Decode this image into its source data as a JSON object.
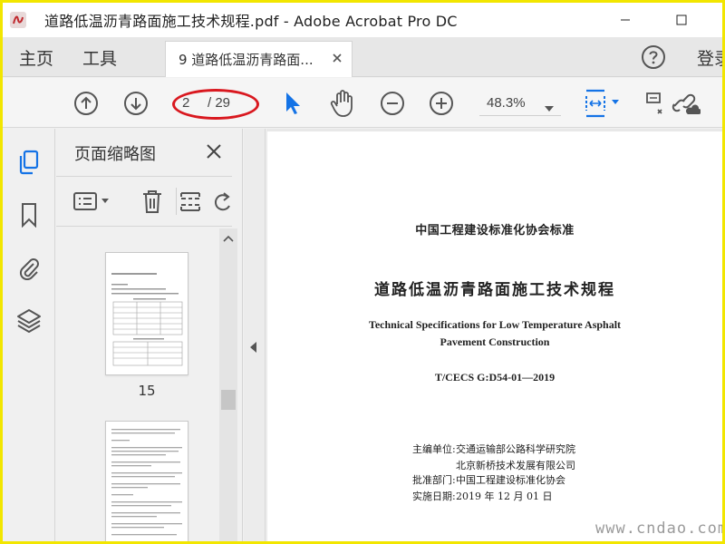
{
  "window": {
    "title": "道路低温沥青路面施工技术规程.pdf - Adobe Acrobat Pro DC"
  },
  "tabs": {
    "home": "主页",
    "tools": "工具",
    "document": "9 道路低温沥青路面...",
    "login": "登录"
  },
  "toolbar": {
    "current_page": "2",
    "page_total": "/ 29",
    "zoom": "48.3%"
  },
  "panel": {
    "title": "页面缩略图",
    "thumbnails": [
      {
        "label": "15"
      },
      {
        "label": ""
      }
    ]
  },
  "document": {
    "org": "中国工程建设标准化协会标准",
    "title": "道路低温沥青路面施工技术规程",
    "title_en_line1": "Technical Specifications for Low Temperature Asphalt",
    "title_en_line2": "Pavement Construction",
    "code": "T/CECS G:D54-01—2019",
    "info": {
      "editor_label": "主编单位:",
      "editor_1": "交通运输部公路科学研究院",
      "editor_2": "北京新桥技术发展有限公司",
      "approval_label": "批准部门:",
      "approval": "中国工程建设标准化协会",
      "date_label": "实施日期:",
      "date": "2019 年 12 月 01 日"
    }
  },
  "watermark": "www.cndao.com",
  "colors": {
    "accent_blue": "#1473e6",
    "annotation_red": "#d9181f",
    "frame_yellow": "#f2e600"
  }
}
